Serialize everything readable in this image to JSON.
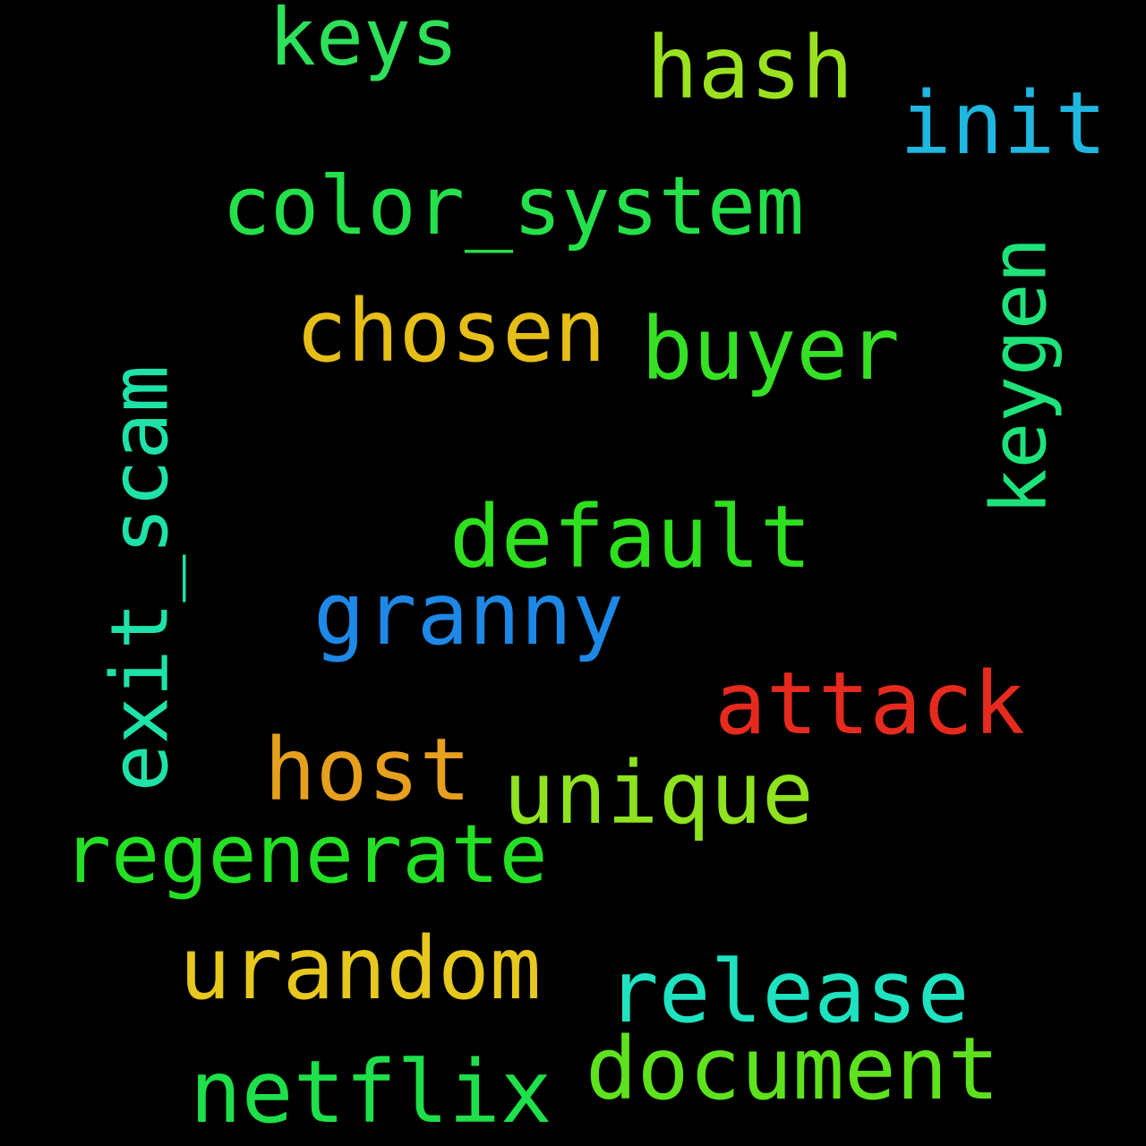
{
  "words": {
    "keys": {
      "text": "keys",
      "color": "#2ee05a"
    },
    "hash": {
      "text": "hash",
      "color": "#9be21e"
    },
    "init": {
      "text": "init",
      "color": "#1fb7e0"
    },
    "color_system": {
      "text": "color_system",
      "color": "#24e04a"
    },
    "chosen": {
      "text": "chosen",
      "color": "#e6be18"
    },
    "buyer": {
      "text": "buyer",
      "color": "#35e025"
    },
    "keygen": {
      "text": "keygen",
      "color": "#1ee27a",
      "orientation": "vertical"
    },
    "exit_scam": {
      "text": "exit_scam",
      "color": "#1ee2a8",
      "orientation": "vertical"
    },
    "default": {
      "text": "default",
      "color": "#2ee01e"
    },
    "granny": {
      "text": "granny",
      "color": "#1e88e6"
    },
    "attack": {
      "text": "attack",
      "color": "#e62a1e"
    },
    "host": {
      "text": "host",
      "color": "#e6a01e"
    },
    "unique": {
      "text": "unique",
      "color": "#8ee21e"
    },
    "regenerate": {
      "text": "regenerate",
      "color": "#24e024"
    },
    "urandom": {
      "text": "urandom",
      "color": "#e6c81e"
    },
    "release": {
      "text": "release",
      "color": "#1ee2c0"
    },
    "document": {
      "text": "document",
      "color": "#5ee21e"
    },
    "netflix": {
      "text": "netflix",
      "color": "#1ee04a"
    }
  }
}
